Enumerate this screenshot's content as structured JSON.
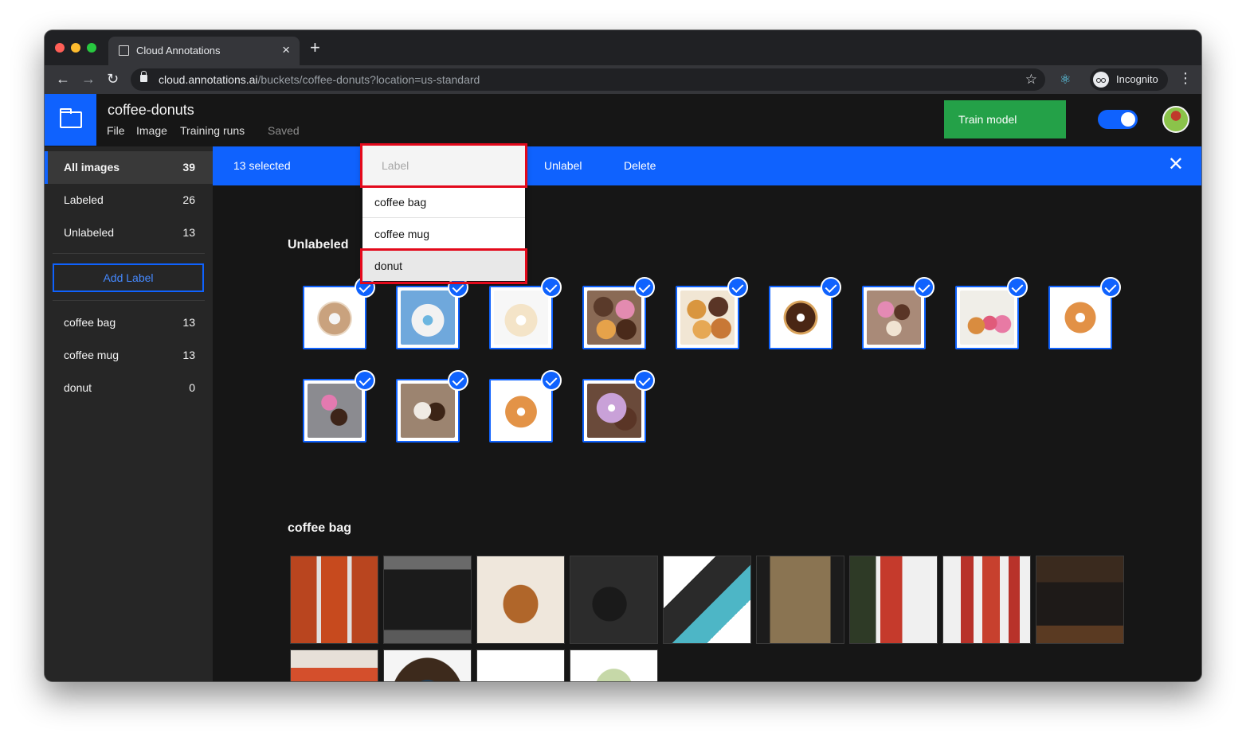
{
  "browser": {
    "tab_title": "Cloud Annotations",
    "tab_close": "×",
    "new_tab": "+",
    "back": "←",
    "forward": "→",
    "reload": "↻",
    "url_host": "cloud.annotations.ai",
    "url_path": "/buckets/coffee-donuts?location=us-standard",
    "star": "☆",
    "extension_icon": "⚛",
    "profile_label": "Incognito",
    "menu": "⋮"
  },
  "header": {
    "bucket_name": "coffee-donuts",
    "menus": [
      "File",
      "Image",
      "Training runs"
    ],
    "save_status": "Saved",
    "train_button": "Train model"
  },
  "sidebar": {
    "filters": [
      {
        "label": "All images",
        "count": "39",
        "active": true
      },
      {
        "label": "Labeled",
        "count": "26",
        "active": false
      },
      {
        "label": "Unlabeled",
        "count": "13",
        "active": false
      }
    ],
    "add_label_button": "Add Label",
    "labels": [
      {
        "label": "coffee bag",
        "count": "13"
      },
      {
        "label": "coffee mug",
        "count": "13"
      },
      {
        "label": "donut",
        "count": "0"
      }
    ]
  },
  "selection_bar": {
    "selected_text": "13 selected",
    "unlabel": "Unlabel",
    "delete": "Delete",
    "close": "✕"
  },
  "label_dropdown": {
    "placeholder": "Label",
    "options": [
      "coffee bag",
      "coffee mug",
      "donut"
    ],
    "highlighted": "donut"
  },
  "sections": {
    "unlabeled_title": "Unlabeled",
    "coffee_bag_title": "coffee bag"
  },
  "unlabeled_images": 13,
  "coffee_bag_images": 13,
  "colors": {
    "accent": "#0f62fe",
    "train_button": "#24a148",
    "highlight_box": "#e3091b",
    "background": "#161616",
    "sidebar": "#262626"
  }
}
